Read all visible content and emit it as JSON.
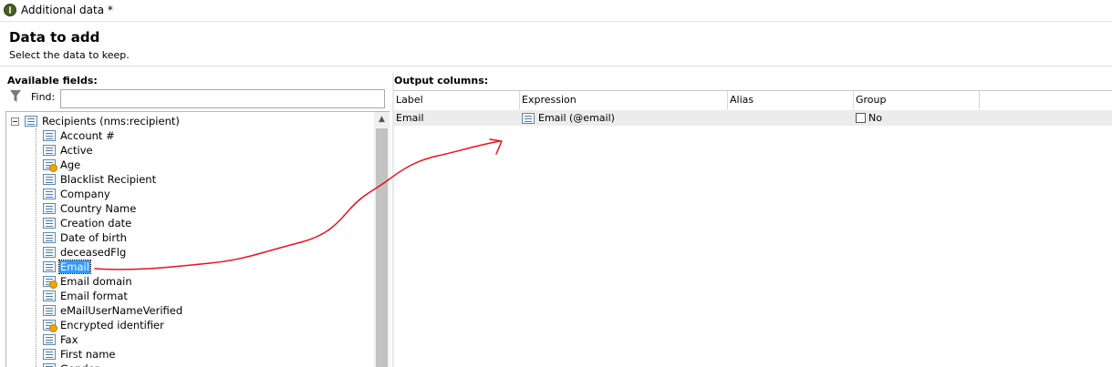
{
  "window": {
    "title": "Additional data *"
  },
  "header": {
    "title": "Data to add",
    "subtitle": "Select the data to keep."
  },
  "left": {
    "label": "Available fields:",
    "find_label": "Find:",
    "find_value": "",
    "tree": {
      "root": "Recipients (nms:recipient)",
      "items": [
        {
          "label": "Account #",
          "icon": "list-field-icon"
        },
        {
          "label": "Active",
          "icon": "list-field-icon"
        },
        {
          "label": "Age",
          "icon": "calculated-field-icon"
        },
        {
          "label": "Blacklist Recipient",
          "icon": "list-field-icon"
        },
        {
          "label": "Company",
          "icon": "list-field-icon"
        },
        {
          "label": "Country Name",
          "icon": "list-field-icon"
        },
        {
          "label": "Creation date",
          "icon": "list-field-icon"
        },
        {
          "label": "Date of birth",
          "icon": "list-field-icon"
        },
        {
          "label": "deceasedFlg",
          "icon": "list-field-icon"
        },
        {
          "label": "Email",
          "icon": "list-field-icon",
          "selected": true
        },
        {
          "label": "Email domain",
          "icon": "calculated-field-icon"
        },
        {
          "label": "Email format",
          "icon": "list-field-icon"
        },
        {
          "label": "eMailUserNameVerified",
          "icon": "list-field-icon"
        },
        {
          "label": "Encrypted identifier",
          "icon": "calculated-field-icon"
        },
        {
          "label": "Fax",
          "icon": "list-field-icon"
        },
        {
          "label": "First name",
          "icon": "list-field-icon"
        },
        {
          "label": "Gender",
          "icon": "list-field-icon"
        }
      ]
    }
  },
  "right": {
    "label": "Output columns:",
    "columns": [
      "Label",
      "Expression",
      "Alias",
      "Group"
    ],
    "rows": [
      {
        "label": "Email",
        "expression": "Email (@email)",
        "alias": "",
        "group": "No"
      }
    ]
  },
  "colors": {
    "selection": "#3399ff",
    "annotation": "#e8121b"
  }
}
